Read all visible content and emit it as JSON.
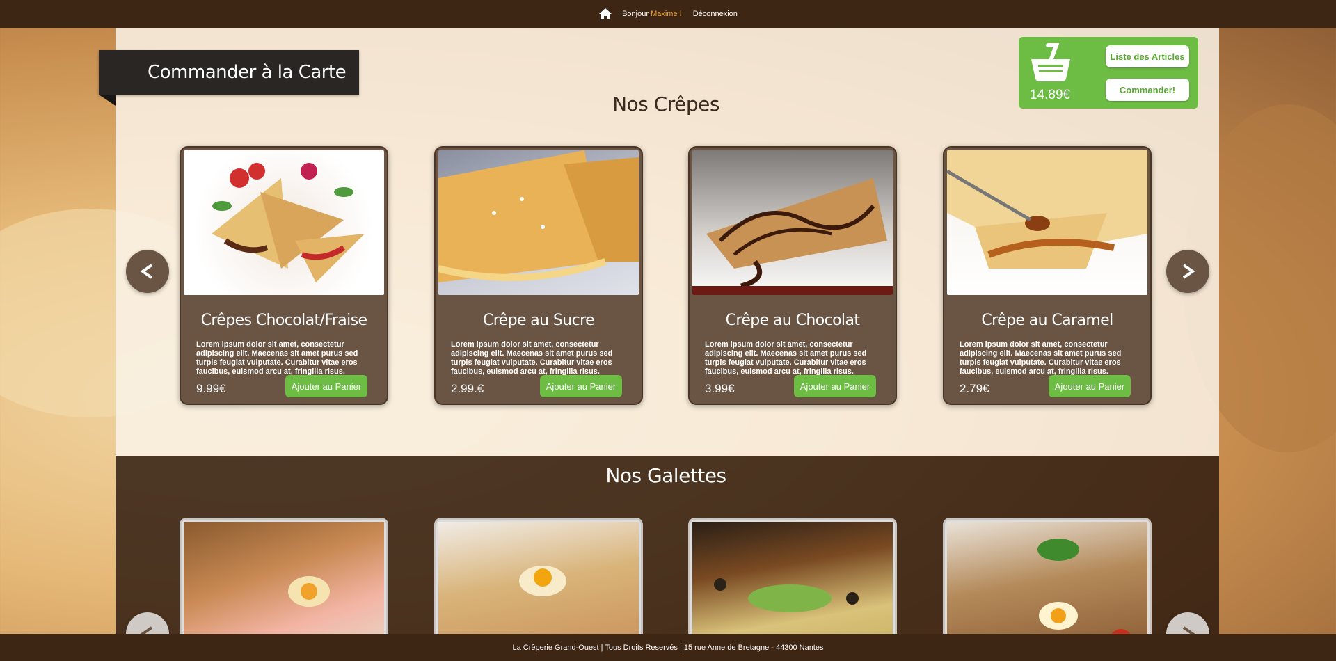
{
  "topbar": {
    "greeting": "Bonjour",
    "user_name": "Maxime",
    "exclamation": "!",
    "logout_label": "Déconnexion"
  },
  "header": {
    "ribbon_title": "Commander à la Carte"
  },
  "cart": {
    "total": "14.89€",
    "list_label": "Liste des Articles",
    "order_label": "Commander!"
  },
  "crepes": {
    "title": "Nos Crêpes",
    "items": [
      {
        "name": "Crêpes Chocolat/Fraise",
        "description": "Lorem ipsum dolor sit amet, consectetur adipiscing elit. Maecenas sit amet purus sed turpis feugiat vulputate. Curabitur vitae eros faucibus, euismod arcu at, fringilla risus.",
        "price": "9.99€",
        "add_label": "Ajouter au Panier"
      },
      {
        "name": "Crêpe au Sucre",
        "description": "Lorem ipsum dolor sit amet, consectetur adipiscing elit. Maecenas sit amet purus sed turpis feugiat vulputate. Curabitur vitae eros faucibus, euismod arcu at, fringilla risus.",
        "price": "2.99.€",
        "add_label": "Ajouter au Panier"
      },
      {
        "name": "Crêpe au Chocolat",
        "description": "Lorem ipsum dolor sit amet, consectetur adipiscing elit. Maecenas sit amet purus sed turpis feugiat vulputate. Curabitur vitae eros faucibus, euismod arcu at, fringilla risus.",
        "price": "3.99€",
        "add_label": "Ajouter au Panier"
      },
      {
        "name": "Crêpe au Caramel",
        "description": "Lorem ipsum dolor sit amet, consectetur adipiscing elit. Maecenas sit amet purus sed turpis feugiat vulputate. Curabitur vitae eros faucibus, euismod arcu at, fringilla risus.",
        "price": "2.79€",
        "add_label": "Ajouter au Panier"
      }
    ]
  },
  "galettes": {
    "title": "Nos Galettes"
  },
  "footer": {
    "text": "La Crêperie Grand-Ouest | Tous Droits Reservés | 15 rue Anne de Bretagne - 44300 Nantes"
  },
  "colors": {
    "topbar": "#3e2615",
    "accent_green": "#6dbd45",
    "username_orange": "#f0a236",
    "card_brown": "#6a5443"
  }
}
